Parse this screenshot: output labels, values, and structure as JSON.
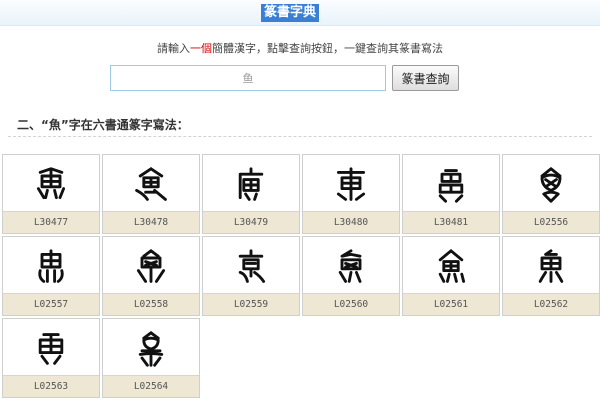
{
  "header": {
    "title": "篆書字典"
  },
  "instruction": {
    "prefix": "請輸入",
    "highlight": "一個",
    "suffix": "簡體漢字，點擊查詢按鈕，一鍵查詢其篆書寫法"
  },
  "search": {
    "value": "鱼",
    "button_label": "篆書查詢"
  },
  "section": {
    "heading": "二、“魚”字在六書通篆字寫法："
  },
  "results": [
    {
      "code": "L30477",
      "glyph_icon": "seal-fish-glyph-icon"
    },
    {
      "code": "L30478",
      "glyph_icon": "seal-fish-glyph-icon"
    },
    {
      "code": "L30479",
      "glyph_icon": "seal-fish-glyph-icon"
    },
    {
      "code": "L30480",
      "glyph_icon": "seal-fish-glyph-icon"
    },
    {
      "code": "L30481",
      "glyph_icon": "seal-fish-glyph-icon"
    },
    {
      "code": "L02556",
      "glyph_icon": "seal-fish-glyph-icon"
    },
    {
      "code": "L02557",
      "glyph_icon": "seal-fish-glyph-icon"
    },
    {
      "code": "L02558",
      "glyph_icon": "seal-fish-glyph-icon"
    },
    {
      "code": "L02559",
      "glyph_icon": "seal-fish-glyph-icon"
    },
    {
      "code": "L02560",
      "glyph_icon": "seal-fish-glyph-icon"
    },
    {
      "code": "L02561",
      "glyph_icon": "seal-fish-glyph-icon"
    },
    {
      "code": "L02562",
      "glyph_icon": "seal-fish-glyph-icon"
    },
    {
      "code": "L02563",
      "glyph_icon": "seal-fish-glyph-icon"
    },
    {
      "code": "L02564",
      "glyph_icon": "seal-fish-glyph-icon"
    }
  ],
  "colors": {
    "title_bg": "#3a7fd5",
    "highlight": "#d40000",
    "code_bar": "#ede7d4",
    "input_border": "#9ccbe8"
  }
}
